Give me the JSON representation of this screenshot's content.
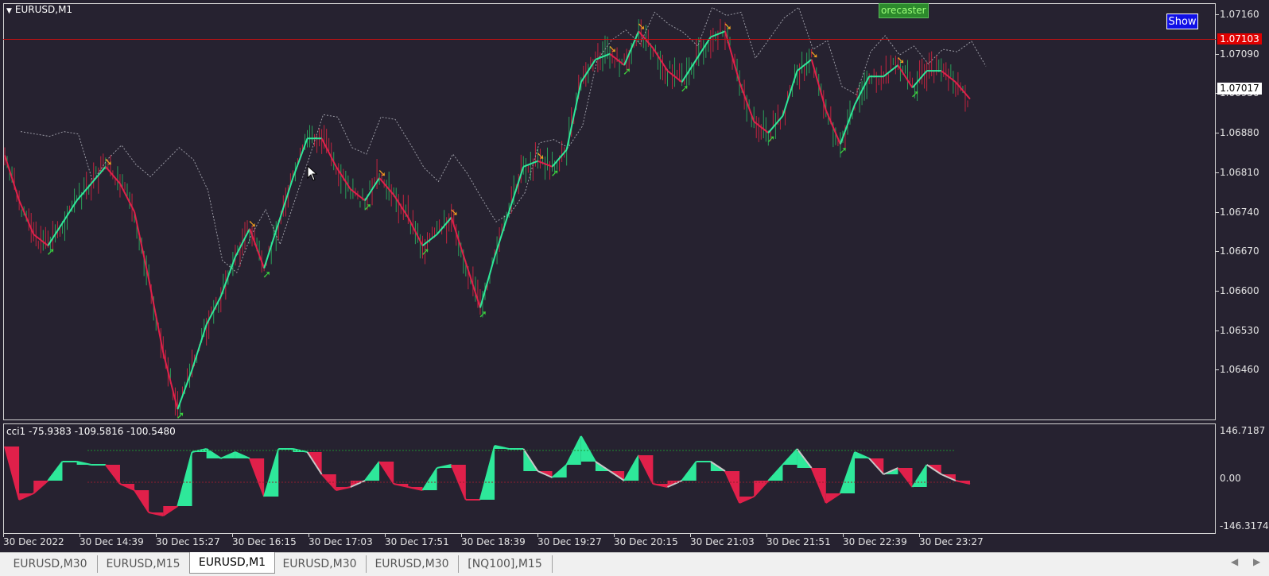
{
  "window": {
    "symbol": "EURUSD,M1",
    "indicator_label": "cci1 -75.9383 -109.5816 -100.5480",
    "show_button": "Show",
    "forecaster_label": "orecaster"
  },
  "price_scale": {
    "ticks": [
      "1.07160",
      "1.07090",
      "1.06950",
      "1.06880",
      "1.06810",
      "1.06740",
      "1.06670",
      "1.06600",
      "1.06530",
      "1.06460"
    ],
    "bid_tag": "1.07103",
    "current_tag": "1.07017"
  },
  "indicator_scale": {
    "ticks": [
      "146.7187",
      "0.00",
      "-146.3174"
    ]
  },
  "time_axis": {
    "ticks": [
      "30 Dec 2022",
      "30 Dec 14:39",
      "30 Dec 15:27",
      "30 Dec 16:15",
      "30 Dec 17:03",
      "30 Dec 17:51",
      "30 Dec 18:39",
      "30 Dec 19:27",
      "30 Dec 20:15",
      "30 Dec 21:03",
      "30 Dec 21:51",
      "30 Dec 22:39",
      "30 Dec 23:27"
    ]
  },
  "tabs": [
    {
      "label": "EURUSD,M30",
      "active": false
    },
    {
      "label": "EURUSD,M15",
      "active": false
    },
    {
      "label": "EURUSD,M1",
      "active": true
    },
    {
      "label": "EURUSD,M30",
      "active": false
    },
    {
      "label": "EURUSD,M30",
      "active": false
    },
    {
      "label": "[NQ100],M15",
      "active": false
    }
  ],
  "colors": {
    "background": "#262230",
    "bull": "#2ee89a",
    "bear": "#e0204a",
    "neutral": "#c8c8c8",
    "bid_line": "#c81010"
  },
  "chart_data": {
    "type": "line",
    "ylim": [
      1.0643,
      1.0719
    ],
    "series": [
      {
        "values": [
          1.069,
          1.0682,
          1.0676,
          1.0674,
          1.0678,
          1.0682,
          1.0685,
          1.0688,
          1.0685,
          1.068,
          1.0668,
          1.0655,
          1.0645,
          1.0652,
          1.066,
          1.0665,
          1.0672,
          1.0677,
          1.067,
          1.0678,
          1.0686,
          1.0693,
          1.0693,
          1.0688,
          1.0684,
          1.0682,
          1.0686,
          1.0683,
          1.0679,
          1.0674,
          1.0676,
          1.0679,
          1.0671,
          1.0663,
          1.0672,
          1.068,
          1.0688,
          1.0689,
          1.0688,
          1.0691,
          1.0703,
          1.0707,
          1.0708,
          1.0706,
          1.0712,
          1.0709,
          1.0705,
          1.0703,
          1.0707,
          1.0711,
          1.0712,
          1.0703,
          1.0696,
          1.0694,
          1.0697,
          1.0705,
          1.0707,
          1.0698,
          1.0692,
          1.0699,
          1.0704,
          1.0704,
          1.0706,
          1.0702,
          1.0705,
          1.0705,
          1.0703,
          1.07
        ]
      }
    ]
  }
}
